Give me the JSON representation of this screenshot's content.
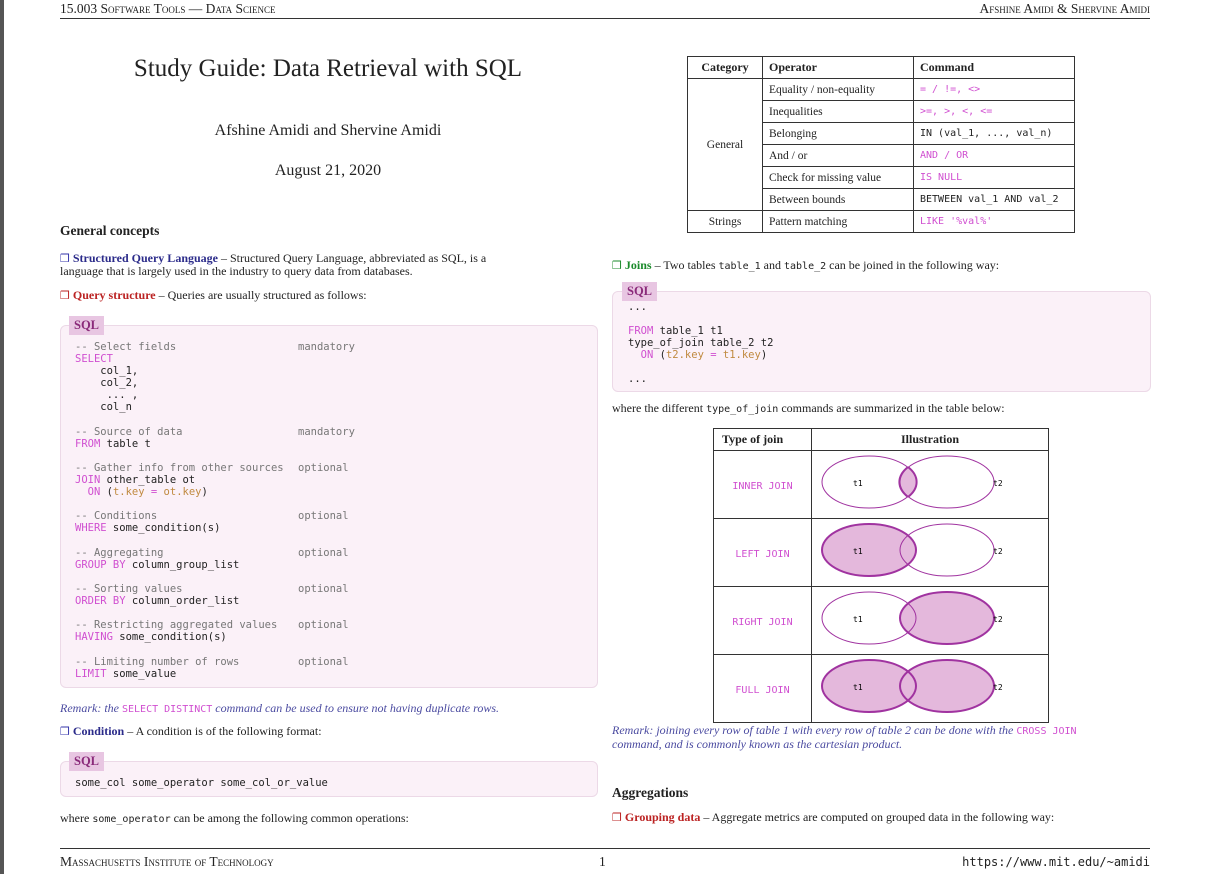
{
  "header": {
    "left": "15.003 Software Tools — Data Science",
    "right": "Afshine Amidi & Shervine Amidi"
  },
  "title": {
    "main": "Study Guide: Data Retrieval with SQL",
    "authors": "Afshine Amidi and Shervine Amidi",
    "date": "August 21, 2020"
  },
  "general": {
    "heading": "General concepts",
    "sql_term": "Structured Query Language",
    "sql_desc_1": " – Structured Query Language, abbreviated as SQL, is a",
    "sql_desc_2": "language that is largely used in the industry to query data from databases.",
    "qs_term": "Query structure",
    "qs_desc": " – Queries are usually structured as follows:",
    "sql_tag": "SQL",
    "query_blocks": [
      {
        "comment": "-- Select fields",
        "code": "SELECT\n    col_1,\n    col_2,\n     ... ,\n    col_n",
        "kw": "SELECT",
        "note": "mandatory"
      },
      {
        "comment": "-- Source of data",
        "kw": "FROM",
        "code": " table t",
        "note": "mandatory"
      },
      {
        "comment": "-- Gather info from other sources",
        "kw": "JOIN",
        "code": " other_table ot",
        "note": "optional"
      },
      {
        "comment": "-- Conditions",
        "kw": "WHERE",
        "code": " some_condition(s)",
        "note": "optional"
      },
      {
        "comment": "-- Aggregating",
        "kw": "GROUP BY",
        "code": " column_group_list",
        "note": "optional"
      },
      {
        "comment": "-- Sorting values",
        "kw": "ORDER BY",
        "code": " column_order_list",
        "note": "optional"
      },
      {
        "comment": "-- Restricting aggregated values",
        "kw": "HAVING",
        "code": " some_condition(s)",
        "note": "optional"
      },
      {
        "comment": "-- Limiting number of rows",
        "kw": "LIMIT",
        "code": " some_value",
        "note": "optional"
      }
    ],
    "join_on": "ON",
    "join_cond_a": "t.key",
    "join_eq": " = ",
    "join_cond_b": "ot.key",
    "remark1_pre": "Remark: the ",
    "remark1_code": "SELECT DISTINCT",
    "remark1_post": " command can be used to ensure not having duplicate rows.",
    "cond_term": "Condition",
    "cond_desc": " – A condition is of the following format:",
    "cond_code": "some_col some_operator some_col_or_value",
    "where_pre": "where ",
    "where_code": "some_operator",
    "where_post": " can be among the following common operations:"
  },
  "operators_table": {
    "headers": [
      "Category",
      "Operator",
      "Command"
    ],
    "general_label": "General",
    "strings_label": "Strings",
    "rows": [
      {
        "op": "Equality / non-equality",
        "cmd": "= / !=, <>"
      },
      {
        "op": "Inequalities",
        "cmd": ">=, >, <, <="
      },
      {
        "op": "Belonging",
        "cmd": "IN (val_1, ..., val_n)"
      },
      {
        "op": "And / or",
        "cmd": "AND / OR"
      },
      {
        "op": "Check for missing value",
        "cmd": "IS NULL"
      },
      {
        "op": "Between bounds",
        "cmd": "BETWEEN val_1 AND val_2"
      },
      {
        "op": "Pattern matching",
        "cmd": "LIKE '%val%'"
      }
    ]
  },
  "joins": {
    "term": "Joins",
    "desc_pre": " – Two tables ",
    "t1": "table_1",
    "and": " and ",
    "t2": "table_2",
    "desc_post": " can be joined in the following way:",
    "code_dots_top": "...",
    "code_from": "FROM",
    "code_from_rest": " table_1 t1",
    "code_type": "type_of_join table_2 t2",
    "code_on": "ON",
    "code_cond_a": "t2.key",
    "code_eq": " = ",
    "code_cond_b": "t1.key",
    "code_dots_bottom": "...",
    "where_pre": "where the different ",
    "where_code": "type_of_join",
    "where_post": " commands are summarized in the table below:",
    "table_headers": [
      "Type of join",
      "Illustration"
    ],
    "types": [
      "INNER JOIN",
      "LEFT JOIN",
      "RIGHT JOIN",
      "FULL JOIN"
    ],
    "label_t1": "t1",
    "label_t2": "t2",
    "remark_pre": "Remark: joining every row of table 1 with every row of table 2 can be done with the ",
    "remark_code": "CROSS JOIN",
    "remark_line2": "command, and is commonly known as the cartesian product."
  },
  "aggregations": {
    "heading": "Aggregations",
    "term": "Grouping data",
    "desc": " – Aggregate metrics are computed on grouped data in the following way:"
  },
  "footer": {
    "left": "Massachusetts Institute of Technology",
    "page": "1",
    "right": "https://www.mit.edu/~amidi"
  },
  "colors": {
    "code_bg": "#fbf1f8",
    "sql_tag": "#e8c6e2",
    "keyword_pink": "#d04fd0",
    "accent_red": "#b22222",
    "accent_blue": "#2b2b8a",
    "accent_green": "#1a8a2a",
    "venn_fill": "#e4b8dc",
    "venn_stroke": "#a033a0"
  }
}
